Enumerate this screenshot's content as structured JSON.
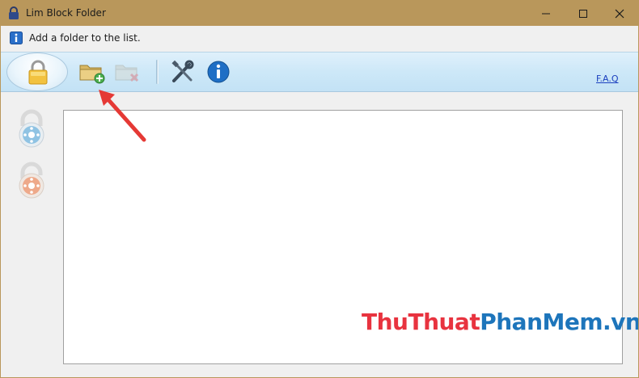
{
  "window": {
    "title": "Lim Block Folder",
    "controls": {
      "minimize": "minimize-icon",
      "maximize": "maximize-icon",
      "close": "close-icon"
    }
  },
  "info_bar": {
    "icon": "info-small-icon",
    "text": "Add a folder to the list."
  },
  "toolbar": {
    "lock_button_icon": "padlock-icon",
    "buttons": [
      {
        "name": "add-folder",
        "icon": "folder-add-icon"
      },
      {
        "name": "remove-folder",
        "icon": "folder-remove-icon"
      },
      {
        "name": "settings",
        "icon": "tools-icon"
      },
      {
        "name": "about",
        "icon": "info-icon"
      }
    ],
    "faq_label": "F.A.Q"
  },
  "sidebar": {
    "items": [
      {
        "name": "lock",
        "icon": "blue-lock-icon"
      },
      {
        "name": "unlock",
        "icon": "orange-unlock-icon"
      }
    ]
  },
  "folder_list": {
    "items": []
  },
  "watermark": {
    "part1": "Thu",
    "part2": "Thuat",
    "part3": "Phan",
    "part4": "Mem",
    "part5": ".vn"
  },
  "colors": {
    "titlebar": "#b9975b",
    "toolbar": "#cde8f8",
    "link": "#1a3fbf",
    "watermark_red": "#e8333f",
    "watermark_blue": "#1d75bb",
    "arrow": "#e53935"
  }
}
